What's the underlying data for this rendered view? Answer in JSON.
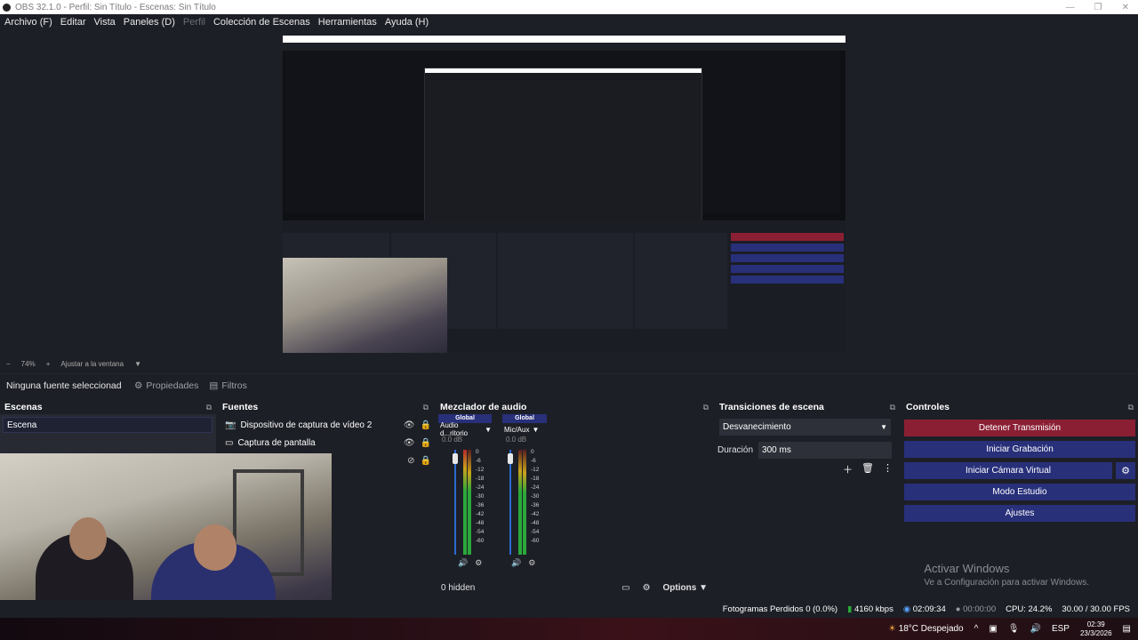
{
  "window": {
    "title": "OBS 32.1.0 - Perfil: Sin Título - Escenas: Sin Título",
    "minimize": "—",
    "maximize": "❐",
    "close": "✕"
  },
  "menu": {
    "items": [
      "Archivo (F)",
      "Editar",
      "Vista",
      "Paneles (D)",
      "Perfil",
      "Colección de Escenas",
      "Herramientas",
      "Ayuda (H)"
    ]
  },
  "zoombar": {
    "minus": "−",
    "zoom": "74%",
    "plus": "+",
    "fit": "Ajustar a la ventana"
  },
  "context": {
    "label": "Ninguna fuente seleccionad",
    "properties": "Propiedades",
    "filters": "Filtros"
  },
  "scenes": {
    "title": "Escenas",
    "items": [
      "Escena"
    ]
  },
  "sources": {
    "title": "Fuentes",
    "items": [
      {
        "label": "Dispositivo de captura de vídeo 2"
      },
      {
        "label": "Captura de pantalla"
      }
    ]
  },
  "mixer": {
    "title": "Mezclador de audio",
    "strips": [
      {
        "head": "Global",
        "name": "Audio d...ritorio",
        "db": "0.0 dB"
      },
      {
        "head": "Global",
        "name": "Mic/Aux",
        "db": "0.0 dB"
      }
    ],
    "scale": [
      "0",
      "-6",
      "-12",
      "-18",
      "-24",
      "-30",
      "-36",
      "-42",
      "-48",
      "-54",
      "-60"
    ],
    "hidden": "0 hidden",
    "options": "Options"
  },
  "transitions": {
    "title": "Transiciones de escena",
    "selected": "Desvanecimiento",
    "duration_label": "Duración",
    "duration_value": "300 ms"
  },
  "controls": {
    "title": "Controles",
    "stop_stream": "Detener Transmisión",
    "start_record": "Iniciar Grabación",
    "virtual_cam": "Iniciar Cámara Virtual",
    "studio": "Modo Estudio",
    "settings": "Ajustes"
  },
  "watermark": {
    "line1": "Activar Windows",
    "line2": "Ve a Configuración para activar Windows."
  },
  "status": {
    "dropped": "Fotogramas Perdidos 0 (0.0%)",
    "bitrate": "4160 kbps",
    "stream_time": "02:09:34",
    "rec_time": "00:00:00",
    "cpu": "CPU: 24.2%",
    "fps": "30.00 / 30.00 FPS"
  },
  "taskbar": {
    "weather": "18°C  Despejado",
    "lang": "ESP",
    "time": "02:39",
    "date": "23/3/2026"
  },
  "colors": {
    "accent": "#28307a",
    "stop": "#8a1f34",
    "panel": "#272a33",
    "bg": "#1d1f26"
  }
}
